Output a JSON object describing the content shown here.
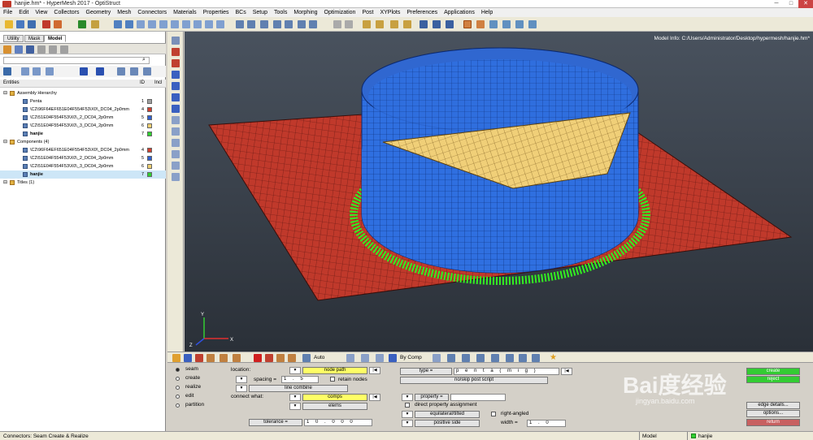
{
  "window": {
    "title": "hanjie.hm* - HyperMesh 2017 - OptiStruct",
    "min": "─",
    "max": "□",
    "close": "✕"
  },
  "menu": [
    "File",
    "Edit",
    "View",
    "Collectors",
    "Geometry",
    "Mesh",
    "Connectors",
    "Materials",
    "Properties",
    "BCs",
    "Setup",
    "Tools",
    "Morphing",
    "Optimization",
    "Post",
    "XYPlots",
    "Preferences",
    "Applications",
    "Help"
  ],
  "browser": {
    "tabs": [
      "Utility",
      "Mask",
      "Model"
    ],
    "entities_label": "Entities",
    "id_col": "ID",
    "incl_col": "Incl",
    "rows": [
      {
        "label": "Assembly Hierarchy",
        "indent": 0,
        "id": "",
        "color": ""
      },
      {
        "label": "Penta",
        "indent": 1,
        "id": "1",
        "color": "#a0a0a0"
      },
      {
        "label": "\\C2\\96F64EF651E04F554F53\\X0\\_DC04_2p0mm",
        "indent": 1,
        "id": "4",
        "color": "#d04030"
      },
      {
        "label": "\\C2\\51E04F554F53\\X0\\_2_DC04_2p0mm",
        "indent": 1,
        "id": "5",
        "color": "#3060d0"
      },
      {
        "label": "\\C2\\51E04F554F53\\X0\\_3_DC04_2p0mm",
        "indent": 1,
        "id": "6",
        "color": "#f0d070"
      },
      {
        "label": "hanjie",
        "indent": 1,
        "id": "7",
        "color": "#30d030",
        "bold": true
      },
      {
        "label": "Components (4)",
        "indent": 0,
        "id": "",
        "color": ""
      },
      {
        "label": "\\C2\\96F64EF651E04F554F53\\X0\\_DC04_2p0mm",
        "indent": 1,
        "id": "4",
        "color": "#d04030"
      },
      {
        "label": "\\C2\\51E04F554F53\\X0\\_2_DC04_2p0mm",
        "indent": 1,
        "id": "5",
        "color": "#3060d0"
      },
      {
        "label": "\\C2\\51E04F554F53\\X0\\_3_DC04_2p0mm",
        "indent": 1,
        "id": "6",
        "color": "#f0d070"
      },
      {
        "label": "hanjie",
        "indent": 1,
        "id": "7",
        "color": "#30d030",
        "bold": true,
        "selected": true
      },
      {
        "label": "Titles (1)",
        "indent": 0,
        "id": "",
        "color": ""
      }
    ]
  },
  "viewport": {
    "model_info": "Model Info: C:/Users/Administrator/Desktop/hypermesh/hanjie.hm*",
    "axis": {
      "x": "X",
      "y": "Y",
      "z": "Z"
    }
  },
  "bottom_toolbar": {
    "auto": "Auto",
    "bycomp": "By Comp"
  },
  "form": {
    "modes": [
      {
        "label": "seam",
        "selected": true
      },
      {
        "label": "create",
        "selected": false
      },
      {
        "label": "realize",
        "selected": false
      },
      {
        "label": "edit",
        "selected": false
      },
      {
        "label": "partition",
        "selected": false
      }
    ],
    "location_label": "location:",
    "location_btn": "node path",
    "spacing_label": "spacing =",
    "spacing_val": "1 . 5",
    "retain_nodes": "retain nodes",
    "line_combine": "line combine",
    "connect_what": "connect what:",
    "comps": "comps",
    "elems": "elems",
    "tolerance_label": "tolerance =",
    "tolerance_val": "1 0 . 0 0 0",
    "type_label": "type =",
    "type_val": "p e n t a   ( m i g )",
    "noskip": "no/skip post script",
    "property_label": "property =",
    "direct_prop": "direct property assignment",
    "equilateral": "equilateral/tilted",
    "right_angled": "right-angled",
    "positive_side": "positive side",
    "width_label": "width =",
    "width_val": "1 . 0",
    "create": "create",
    "reject": "reject",
    "edge_details": "edge details...",
    "options": "options...",
    "return": "return"
  },
  "status": {
    "left": "Connectors: Seam Create & Realize",
    "model": "Model",
    "comp": "hanjie"
  },
  "watermark": {
    "line1": "Bai度经验",
    "line2": "jingyan.baidu.com"
  },
  "colors": {
    "plate": "#c0392b",
    "cylinder": "#2f6fe0",
    "cap": "#f0cf78",
    "weld": "#33ee22"
  }
}
